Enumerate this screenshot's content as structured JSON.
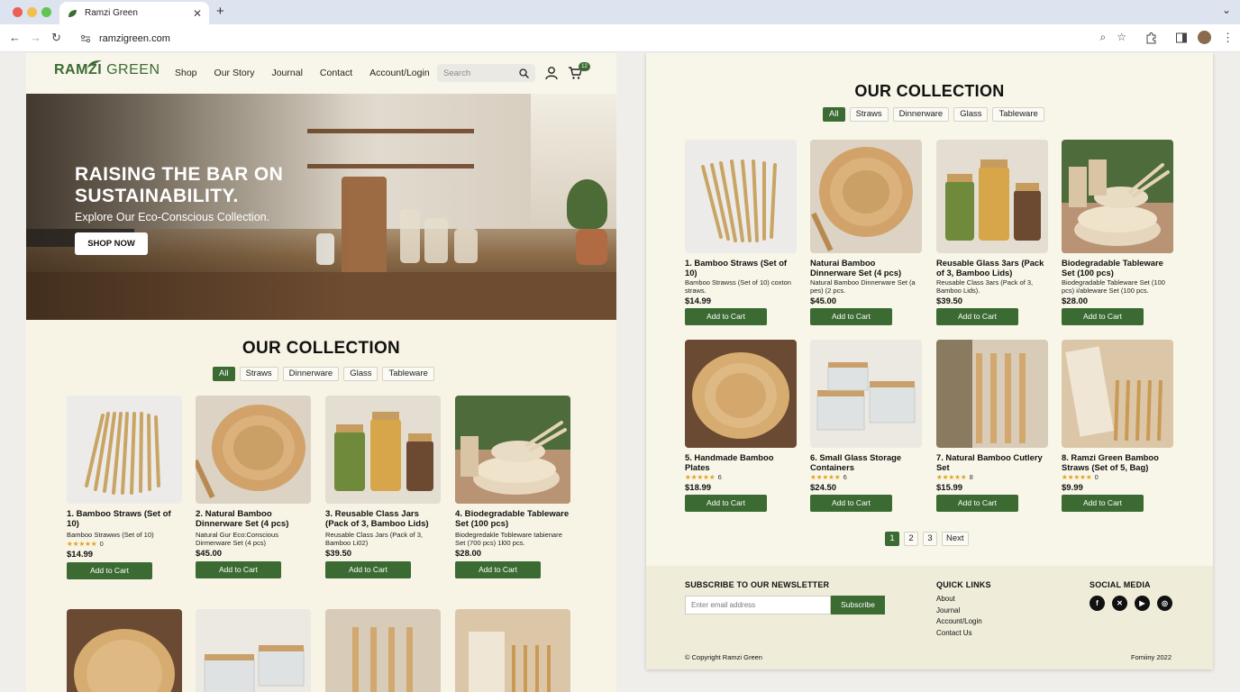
{
  "browser": {
    "tab_title": "Ramzi Green",
    "url": "ramzigreen.com"
  },
  "header": {
    "logo_main": "RAMZI",
    "logo_accent": "GREEN",
    "nav": [
      "Shop",
      "Our Story",
      "Journal",
      "Contact",
      "Account/Login"
    ],
    "search_placeholder": "Search",
    "cart_count": "12"
  },
  "hero": {
    "headline": "RAISING THE BAR ON SUSTAINABILITY.",
    "subheadline": "Explore Our Eco-Conscious Collection.",
    "cta": "SHOP NOW"
  },
  "collection_left": {
    "title": "OUR COLLECTION",
    "filters": [
      "All",
      "Straws",
      "Dinnerware",
      "Glass",
      "Tableware"
    ],
    "active_filter": "All",
    "products": [
      {
        "name": "1. Bamboo Straws (Set of 10)",
        "desc": "Bamboo Strawws (Set of 10)",
        "stars": "★★★★★",
        "reviews": "0",
        "price": "$14.99",
        "button": "Add to Cart"
      },
      {
        "name": "2. Natural Bamboo Dinnerware Set (4 pcs)",
        "desc": "Natural Gur Eco:Conscious Dirmerware Set (4 pcs)",
        "stars": "",
        "reviews": "",
        "price": "$45.00",
        "button": "Add to Cart"
      },
      {
        "name": "3. Reusable Class Jars (Pack of 3, Bamboo Lids)",
        "desc": "Reusable Class Jars (Pack of 3, Bamboo Li02)",
        "stars": "",
        "reviews": "",
        "price": "$39.50",
        "button": "Add to Cart"
      },
      {
        "name": "4. Biodegradable Tableware Set (100 pcs)",
        "desc": "Biodegredakle Tobleware tabienare Set (700 pcs) 1l00 pcs.",
        "stars": "",
        "reviews": "",
        "price": "$28.00",
        "button": "Add to Cart"
      }
    ]
  },
  "collection_right": {
    "title": "OUR COLLECTION",
    "filters": [
      "All",
      "Straws",
      "Dinnerware",
      "Glass",
      "Tableware"
    ],
    "active_filter": "All",
    "products": [
      {
        "name": "1. Bamboo Straws (Set of 10)",
        "desc": "Bamboo Strawss (Set of 10) coxton straws.",
        "stars": "",
        "reviews": "",
        "price": "$14.99",
        "button": "Add to Cart"
      },
      {
        "name": "Naturai Bamboo Dinnerware Set (4 pcs)",
        "desc": "Natural Bamboo Dinnerware Set (a pes) (2 pcs.",
        "stars": "",
        "reviews": "",
        "price": "$45.00",
        "button": "Add to Cart"
      },
      {
        "name": "Reusable Glass 3ars (Pack of 3, Bamboo Lids)",
        "desc": "Reusable Class 3ars (Pack of 3, Bamboo Lids).",
        "stars": "",
        "reviews": "",
        "price": "$39.50",
        "button": "Add to Cart"
      },
      {
        "name": "Biodegradable Tableware Set (100 pcs)",
        "desc": "Biodegradable Tableware Set (100 pcs) i/ableware Set (100 pcs.",
        "stars": "",
        "reviews": "",
        "price": "$28.00",
        "button": "Add to Cart"
      },
      {
        "name": "5. Handmade Bamboo Plates",
        "desc": "",
        "stars": "★★★★★",
        "reviews": "6",
        "price": "$18.99",
        "button": "Add to Cart"
      },
      {
        "name": "6. Small Glass Storage Containers",
        "desc": "",
        "stars": "★★★★★",
        "reviews": "6",
        "price": "$24.50",
        "button": "Add to Cart"
      },
      {
        "name": "7. Natural Bamboo Cutlery Set",
        "desc": "",
        "stars": "★★★★★",
        "reviews": "8",
        "price": "$15.99",
        "button": "Add to Cart"
      },
      {
        "name": "8. Ramzi Green Bamboo Straws (Set of 5, Bag)",
        "desc": "",
        "stars": "★★★★★",
        "reviews": "0",
        "price": "$9.99",
        "button": "Add to Cart"
      }
    ],
    "pagination": [
      "1",
      "2",
      "3",
      "Next"
    ],
    "active_page": "1"
  },
  "footer": {
    "newsletter_title": "SUBSCRIBE TO OUR NEWSLETTER",
    "email_placeholder": "Enter email address",
    "subscribe": "Subscribe",
    "quick_links_title": "QUICK LINKS",
    "quick_links": [
      "About",
      "Journal",
      "Account/Login",
      "Contact Us"
    ],
    "social_title": "SOCIAL MEDIA",
    "social_icons": [
      "facebook-icon",
      "x-icon",
      "youtube-icon",
      "instagram-icon"
    ],
    "copyright": "© Copyright Ramzi Green",
    "right_note": "Fomiiny 2022"
  },
  "colors": {
    "brand_green": "#3b6b33",
    "page_bg": "#f7f4e6",
    "star": "#e3a21a"
  }
}
